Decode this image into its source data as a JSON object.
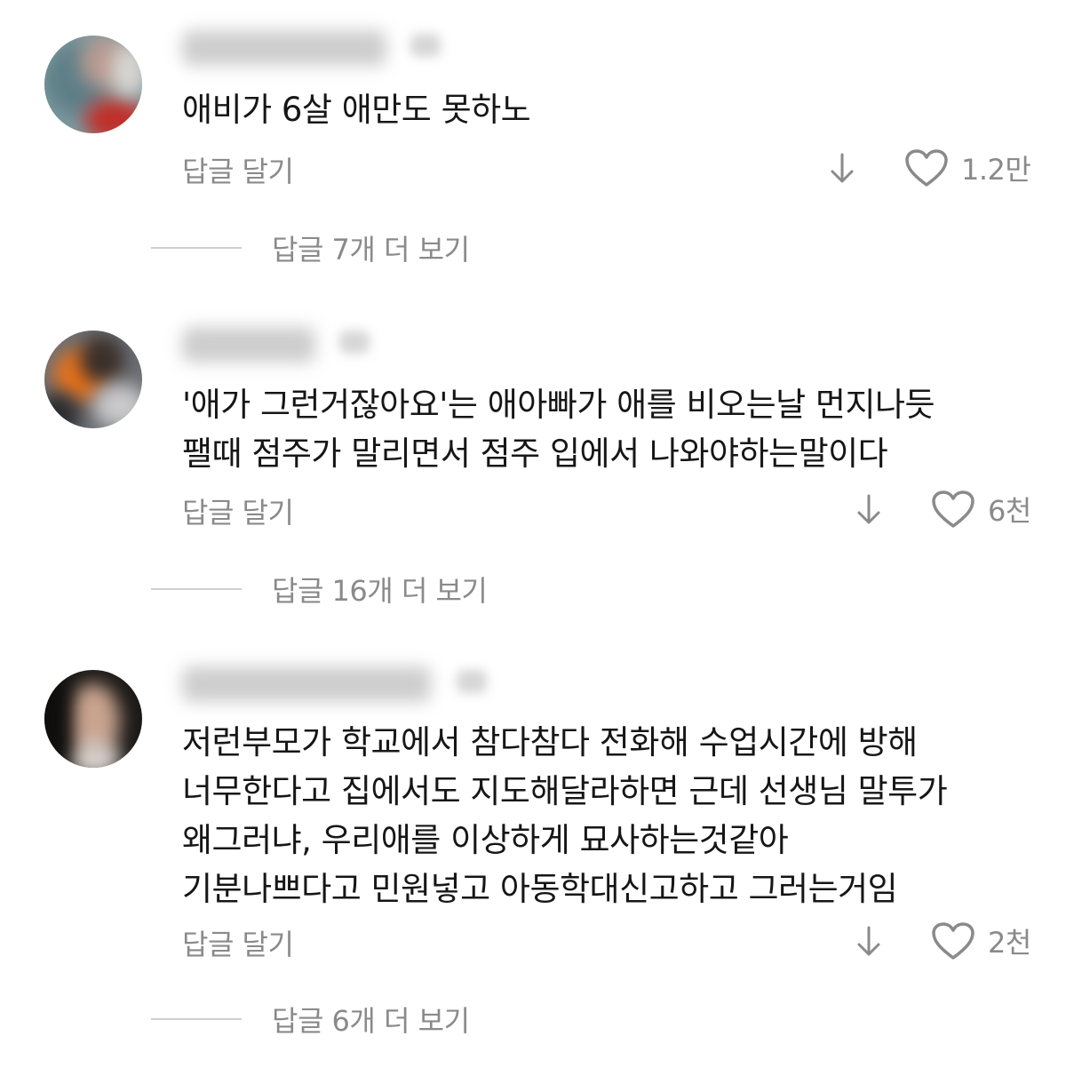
{
  "colors": {
    "text": "#161616",
    "secondary": "#8a8a8a",
    "divider": "#cfcfcf"
  },
  "icons": {
    "dislike": "arrow-down-icon",
    "like": "heart-outline-icon"
  },
  "comments": [
    {
      "lines": [
        "애비가 6살 애만도 못하노"
      ],
      "reply_label": "답글 달기",
      "likes": "1.2만",
      "more_replies": "답글 7개 더 보기"
    },
    {
      "lines": [
        "'애가 그런거잖아요'는 애아빠가 애를 비오는날 먼지나듯",
        "팰때 점주가 말리면서 점주 입에서 나와야하는말이다"
      ],
      "reply_label": "답글 달기",
      "likes": "6천",
      "more_replies": "답글 16개 더 보기"
    },
    {
      "lines": [
        "저런부모가 학교에서 참다참다 전화해 수업시간에 방해",
        "너무한다고 집에서도 지도해달라하면 근데 선생님 말투가",
        "왜그러냐, 우리애를 이상하게 묘사하는것같아",
        "기분나쁘다고 민원넣고 아동학대신고하고 그러는거임"
      ],
      "reply_label": "답글 달기",
      "likes": "2천",
      "more_replies": "답글 6개 더 보기"
    }
  ]
}
